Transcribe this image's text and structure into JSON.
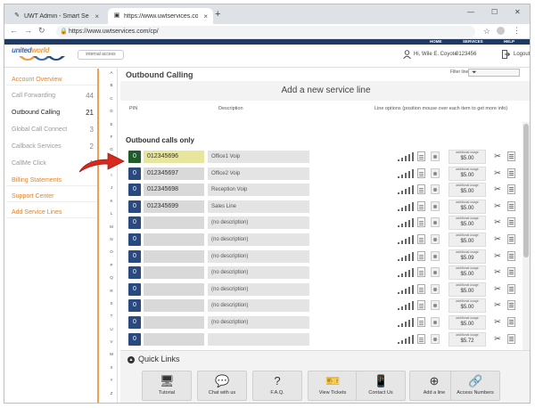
{
  "browser": {
    "tabs": [
      {
        "title": "UWT Admin - Smart Search",
        "active": false
      },
      {
        "title": "https://www.uwtservices.com/cp/",
        "active": true
      }
    ],
    "url": "https://www.uwtservices.com/cp/"
  },
  "site": {
    "nav": [
      "HOME",
      "SERVICES",
      "HELP"
    ],
    "logo_text_a": "united",
    "logo_text_b": "world",
    "internal_access": "internal access",
    "greeting": "Hi, Wile E. Coyote",
    "account_number": "0123456",
    "logout": "Logout"
  },
  "sidebar": {
    "section_account": "Account Overview",
    "items": [
      {
        "label": "Call Forwarding",
        "count": "44"
      },
      {
        "label": "Outbound Calling",
        "count": "21"
      },
      {
        "label": "Global Call Connect",
        "count": "3"
      },
      {
        "label": "Callback Services",
        "count": "2"
      },
      {
        "label": "CallMe Click",
        "count": "1"
      }
    ],
    "section_billing": "Billing Statements",
    "section_support": "Support Center",
    "section_add": "Add Service Lines"
  },
  "alphabet": [
    "A",
    "B",
    "C",
    "D",
    "E",
    "F",
    "G",
    "H",
    "I",
    "J",
    "K",
    "L",
    "M",
    "N",
    "O",
    "P",
    "Q",
    "R",
    "S",
    "T",
    "U",
    "V",
    "W",
    "X",
    "Y",
    "Z"
  ],
  "main": {
    "title": "Outbound Calling",
    "filter_label": "Filter lines",
    "add_line": "Add a new service line",
    "col_pin": "PIN",
    "col_desc": "Description",
    "col_options": "Line options (position mouse over each item to get more info)",
    "section": "Outbound calls only",
    "usage_label": "additional usage",
    "rows": [
      {
        "idx": "0",
        "pin": "012345696",
        "desc": "Office1 Voip",
        "usage": "$5.00",
        "highlight": true
      },
      {
        "idx": "0",
        "pin": "012345697",
        "desc": "Office2 Voip",
        "usage": "$5.00",
        "highlight": false
      },
      {
        "idx": "0",
        "pin": "012345698",
        "desc": "Reception Voip",
        "usage": "$5.00",
        "highlight": false
      },
      {
        "idx": "0",
        "pin": "012345699",
        "desc": "Sales Line",
        "usage": "$5.00",
        "highlight": false
      },
      {
        "idx": "0",
        "pin": "",
        "desc": "(no description)",
        "usage": "$5.00",
        "highlight": false
      },
      {
        "idx": "0",
        "pin": "",
        "desc": "(no description)",
        "usage": "$5.00",
        "highlight": false
      },
      {
        "idx": "0",
        "pin": "",
        "desc": "(no description)",
        "usage": "$5.09",
        "highlight": false
      },
      {
        "idx": "0",
        "pin": "",
        "desc": "(no description)",
        "usage": "$5.00",
        "highlight": false
      },
      {
        "idx": "0",
        "pin": "",
        "desc": "(no description)",
        "usage": "$5.00",
        "highlight": false
      },
      {
        "idx": "0",
        "pin": "",
        "desc": "(no description)",
        "usage": "$5.00",
        "highlight": false
      },
      {
        "idx": "0",
        "pin": "",
        "desc": "(no description)",
        "usage": "$5.00",
        "highlight": false
      },
      {
        "idx": "0",
        "pin": "",
        "desc": "",
        "usage": "$5.72",
        "highlight": false
      }
    ]
  },
  "quick_links": {
    "title": "Quick Links",
    "items": [
      {
        "label": "Tutorial",
        "icon": "monitor-icon"
      },
      {
        "label": "Chat with us",
        "icon": "chat-icon"
      },
      {
        "label": "F.A.Q.",
        "icon": "question-icon"
      },
      {
        "label": "View Tickets",
        "icon": "ticket-icon"
      },
      {
        "label": "Contact Us",
        "icon": "phone-icon"
      },
      {
        "label": "Add a line",
        "icon": "plus-circle-icon"
      },
      {
        "label": "Access Numbers",
        "icon": "link-icon"
      }
    ]
  }
}
